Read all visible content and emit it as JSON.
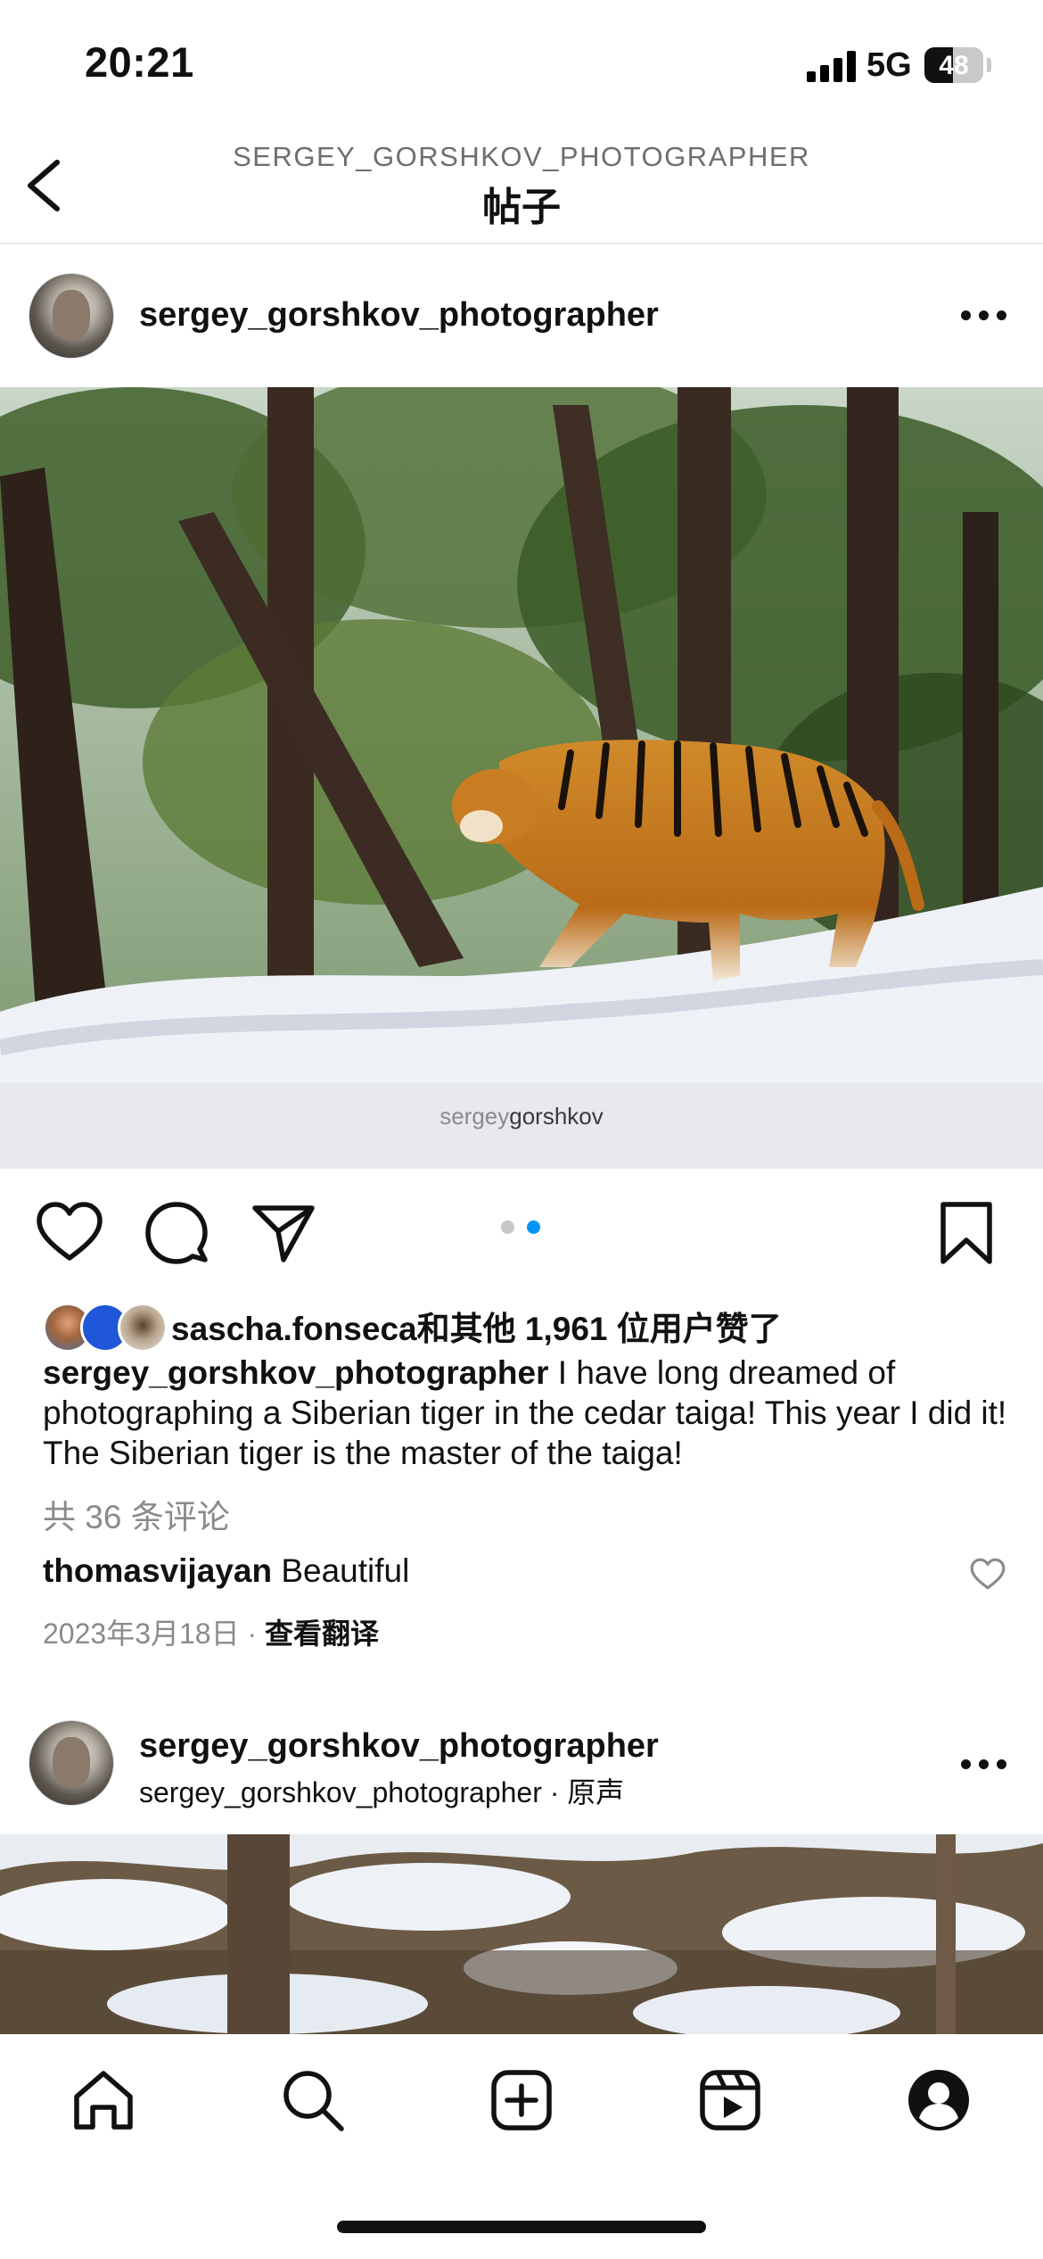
{
  "status_bar": {
    "time": "20:21",
    "network": "5G",
    "battery": "48"
  },
  "header": {
    "username": "SERGEY_GORSHKOV_PHOTOGRAPHER",
    "title": "帖子"
  },
  "post1": {
    "username": "sergey_gorshkov_photographer",
    "watermark_light": "sergey",
    "watermark_dark": "gorshkov",
    "likes": {
      "user": "sascha.fonseca",
      "rest": "和其他 1,961 位用户赞了"
    },
    "caption": {
      "username": "sergey_gorshkov_photographer",
      "text": "I have long dreamed of photographing a Siberian tiger in the cedar taiga!  This year I did it!  The Siberian tiger is the master of the taiga!"
    },
    "comments_link": "共 36 条评论",
    "top_comment": {
      "user": "thomasvijayan",
      "text": "Beautiful"
    },
    "date": "2023年3月18日",
    "translate": "查看翻译"
  },
  "post2": {
    "username": "sergey_gorshkov_photographer",
    "audio": "sergey_gorshkov_photographer · 原声"
  },
  "colors": {
    "accent": "#0095f6",
    "muted": "#8a8a8a"
  },
  "icons": [
    "chevron-left-icon",
    "more-icon",
    "heart-icon",
    "comment-icon",
    "share-icon",
    "bookmark-icon",
    "home-icon",
    "search-icon",
    "create-icon",
    "reels-icon",
    "profile-icon"
  ]
}
